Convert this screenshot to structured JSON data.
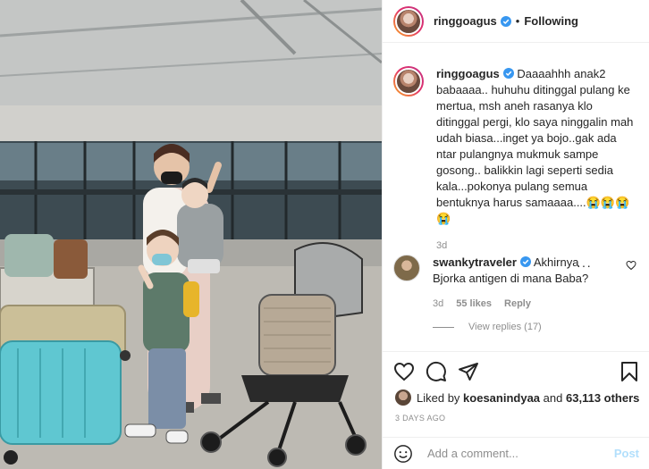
{
  "header": {
    "username": "ringgoagus",
    "separator": "•",
    "follow_label": "Following"
  },
  "caption": {
    "username": "ringgoagus",
    "text": "Daaaahhh anak2 babaaaa.. huhuhu ditinggal pulang ke mertua, msh aneh rasanya klo ditinggal pergi, klo saya ninggalin mah udah biasa...inget ya bojo..gak ada ntar pulangnya mukmuk sampe gosong.. balikkin lagi seperti sedia kala...pokonya pulang semua bentuknya harus samaaaa....😭😭😭 😭",
    "time": "3d"
  },
  "comment": {
    "username": "swankytraveler",
    "text": "Akhirnya Bjorka antigen di mana Baba?",
    "time": "3d",
    "likes": "55 likes",
    "reply_label": "Reply",
    "more": "···"
  },
  "view_replies": "View replies (17)",
  "likes": {
    "prefix": "Liked by ",
    "user": "koesanindyaa",
    "and": " and ",
    "count": "63,113 others"
  },
  "date": "3 DAYS AGO",
  "add_comment": {
    "placeholder": "Add a comment...",
    "post_label": "Post"
  },
  "icons": {
    "verified": "verified-badge-icon",
    "like": "heart-icon",
    "comment": "comment-bubble-icon",
    "share": "paper-plane-icon",
    "save": "bookmark-icon",
    "emoji": "smiley-icon"
  },
  "colors": {
    "verified": "#3897f0",
    "post_disabled": "#b2dffc",
    "muted": "#8e8e8e"
  }
}
